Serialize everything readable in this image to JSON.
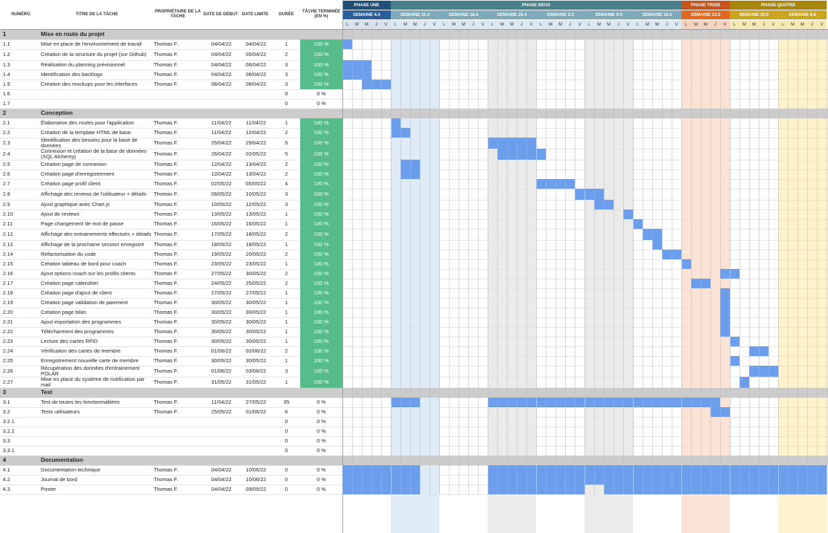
{
  "headers": {
    "num": "NUMÉRO",
    "title": "TITRE DE LA TÂCHE",
    "owner": "PROPRIÉTAIRE DE LA TÂCHE",
    "start": "DATE DE DÉBUT",
    "end": "DATE LIMITE",
    "dur": "DURÉE",
    "pct": "TÂCHE TERMINÉE (EN %)"
  },
  "day_letters": [
    "L",
    "M",
    "M",
    "J",
    "V"
  ],
  "phases": [
    {
      "label": "PHASE UNE",
      "color": "#1f4e79",
      "text": "#ffffff",
      "weeks": 1
    },
    {
      "label": "PHASE DEUX",
      "color": "#4a7f8c",
      "text": "#ffffff",
      "weeks": 6
    },
    {
      "label": "PHASE TROIS",
      "color": "#c4541b",
      "text": "#ffffff",
      "weeks": 1
    },
    {
      "label": "PHASE QUATRE",
      "color": "#a8860e",
      "text": "#ffffff",
      "weeks": 2
    }
  ],
  "weeks": [
    {
      "label": "SEMAINE 4.4",
      "color": "#2a5d9a",
      "daybg": "#d9e3f0",
      "fill": "#ffffff"
    },
    {
      "label": "SEMAINE 11.4",
      "color": "#7faabc",
      "daybg": "#dbe9f2",
      "fill": "#dfecf7"
    },
    {
      "label": "SEMAINE 18.4",
      "color": "#7faabc",
      "daybg": "#dbe9f2",
      "fill": "#ffffff"
    },
    {
      "label": "SEMAINE 25.4",
      "color": "#7faabc",
      "daybg": "#dbe9f2",
      "fill": "#ebebeb"
    },
    {
      "label": "SEMAINE 2.5",
      "color": "#7faabc",
      "daybg": "#dbe9f2",
      "fill": "#ffffff"
    },
    {
      "label": "SEMAINE 9.5",
      "color": "#7faabc",
      "daybg": "#dbe9f2",
      "fill": "#ebebeb"
    },
    {
      "label": "SEMAINE 16.5",
      "color": "#7faabc",
      "daybg": "#dbe9f2",
      "fill": "#ffffff"
    },
    {
      "label": "SEMAINE 23.5",
      "color": "#e0691f",
      "daybg": "#f8d3c0",
      "fill": "#fbe3d6"
    },
    {
      "label": "SEMAINE 30.5",
      "color": "#c9a522",
      "daybg": "#f7e9b4",
      "fill": "#ffffff"
    },
    {
      "label": "SEMAINE 6.6",
      "color": "#c9a522",
      "daybg": "#f7e9b4",
      "fill": "#fff2cc"
    }
  ],
  "colors": {
    "done": "#57bb8a",
    "bar": "#6d9eeb",
    "section": "#cccccc"
  },
  "rows": [
    {
      "type": "section",
      "num": "1",
      "title": "Mise en route du projet"
    },
    {
      "num": "1.1",
      "title": "Mise en place de l'environnement de travail",
      "owner": "Thomas F.",
      "start": "04/04/22",
      "end": "04/04/22",
      "dur": "1",
      "pct": "100 %",
      "done": true,
      "bars": [
        [
          0,
          1
        ]
      ]
    },
    {
      "num": "1.2",
      "title": "Création de la structure du projet (sur Github)",
      "owner": "Thomas F.",
      "start": "04/04/22",
      "end": "05/04/22",
      "dur": "2",
      "pct": "100 %",
      "done": true,
      "bars": [],
      "tall": true
    },
    {
      "num": "1.3",
      "title": "Réalisation du planning prévisionnel",
      "owner": "Thomas F.",
      "start": "04/04/22",
      "end": "06/04/22",
      "dur": "3",
      "pct": "100 %",
      "done": true,
      "bars": [
        [
          0,
          3
        ]
      ]
    },
    {
      "num": "1.4",
      "title": "Identification des backlogs",
      "owner": "Thomas F.",
      "start": "04/04/22",
      "end": "06/04/22",
      "dur": "3",
      "pct": "100 %",
      "done": true,
      "bars": [
        [
          0,
          3
        ]
      ]
    },
    {
      "num": "1.5",
      "title": "Création des mockups pour les interfaces",
      "owner": "Thomas F.",
      "start": "06/04/22",
      "end": "08/04/22",
      "dur": "3",
      "pct": "100 %",
      "done": true,
      "bars": [
        [
          2,
          3
        ]
      ]
    },
    {
      "num": "1.6",
      "title": "",
      "owner": "",
      "start": "",
      "end": "",
      "dur": "0",
      "pct": "0 %",
      "done": false,
      "bars": []
    },
    {
      "num": "1.7",
      "title": "",
      "owner": "",
      "start": "",
      "end": "",
      "dur": "0",
      "pct": "0 %",
      "done": false,
      "bars": []
    },
    {
      "type": "section",
      "num": "2",
      "title": "Conception"
    },
    {
      "num": "2.1",
      "title": "Élaboration des routes pour l'application",
      "owner": "Thomas F.",
      "start": "11/04/22",
      "end": "11/04/22",
      "dur": "1",
      "pct": "100 %",
      "done": true,
      "bars": [
        [
          5,
          1
        ]
      ]
    },
    {
      "num": "2.2",
      "title": "Création de la template HTML de base",
      "owner": "Thomas F.",
      "start": "11/04/22",
      "end": "12/04/22",
      "dur": "2",
      "pct": "100 %",
      "done": true,
      "bars": [
        [
          5,
          2
        ]
      ]
    },
    {
      "num": "2.3",
      "title": "Identification des besoins pour la base de données",
      "owner": "Thomas F.",
      "start": "25/04/22",
      "end": "29/04/22",
      "dur": "5",
      "pct": "100 %",
      "done": true,
      "bars": [
        [
          15,
          5
        ]
      ],
      "tall": true
    },
    {
      "num": "2.4",
      "title": "Connexion et création de la base de données (SQL Alchemy)",
      "owner": "Thomas F.",
      "start": "26/04/22",
      "end": "02/05/22",
      "dur": "5",
      "pct": "100 %",
      "done": true,
      "bars": [
        [
          16,
          5
        ]
      ],
      "tall": true
    },
    {
      "num": "2.5",
      "title": "Création page de connexion",
      "owner": "Thomas F.",
      "start": "12/04/22",
      "end": "13/04/22",
      "dur": "2",
      "pct": "100 %",
      "done": true,
      "bars": [
        [
          6,
          2
        ]
      ]
    },
    {
      "num": "2.6",
      "title": "Création page d'enregistrement",
      "owner": "Thomas F.",
      "start": "12/04/22",
      "end": "13/04/22",
      "dur": "2",
      "pct": "100 %",
      "done": true,
      "bars": [
        [
          6,
          2
        ]
      ]
    },
    {
      "num": "2.7",
      "title": "Création page profil client",
      "owner": "Thomas F.",
      "start": "02/05/22",
      "end": "05/05/22",
      "dur": "4",
      "pct": "100 %",
      "done": true,
      "bars": [
        [
          20,
          4
        ]
      ]
    },
    {
      "num": "2.8",
      "title": "Affichage des reviews de l'utilisateur + détails",
      "owner": "Thomas F.",
      "start": "06/05/22",
      "end": "10/05/22",
      "dur": "3",
      "pct": "100 %",
      "done": true,
      "bars": [
        [
          24,
          3
        ]
      ],
      "tall": true
    },
    {
      "num": "2.9",
      "title": "Ajout graphique avec Chart.js",
      "owner": "Thomas F.",
      "start": "10/05/22",
      "end": "12/05/22",
      "dur": "3",
      "pct": "100 %",
      "done": true,
      "bars": [
        [
          26,
          2
        ]
      ]
    },
    {
      "num": "2.10",
      "title": "Ajout de reviews",
      "owner": "Thomas F.",
      "start": "13/05/22",
      "end": "13/05/22",
      "dur": "1",
      "pct": "100 %",
      "done": true,
      "bars": [
        [
          29,
          1
        ]
      ]
    },
    {
      "num": "2.11",
      "title": "Page changement de mot de passe",
      "owner": "Thomas F.",
      "start": "16/05/22",
      "end": "16/05/22",
      "dur": "1",
      "pct": "100 %",
      "done": true,
      "bars": [
        [
          30,
          1
        ]
      ]
    },
    {
      "num": "2.12",
      "title": "Affichage des entrainements effectués + détails",
      "owner": "Thomas F.",
      "start": "17/05/22",
      "end": "18/05/22",
      "dur": "2",
      "pct": "100 %",
      "done": true,
      "bars": [
        [
          31,
          2
        ]
      ],
      "tall": true
    },
    {
      "num": "2.13",
      "title": "Affichage de la prochaine session enregistré",
      "owner": "Thomas F.",
      "start": "18/05/22",
      "end": "18/05/22",
      "dur": "1",
      "pct": "100 %",
      "done": true,
      "bars": [
        [
          32,
          1
        ]
      ]
    },
    {
      "num": "2.14",
      "title": "Refactorisation du code",
      "owner": "Thomas F.",
      "start": "19/05/22",
      "end": "20/05/22",
      "dur": "2",
      "pct": "100 %",
      "done": true,
      "bars": [
        [
          33,
          2
        ]
      ]
    },
    {
      "num": "2.15",
      "title": "Création tableau de bord pour coach",
      "owner": "Thomas F.",
      "start": "23/05/22",
      "end": "23/05/22",
      "dur": "1",
      "pct": "100 %",
      "done": true,
      "bars": [
        [
          35,
          1
        ]
      ]
    },
    {
      "num": "2.16",
      "title": "Ajout options coach sur les profils clients",
      "owner": "Thomas F.",
      "start": "27/05/22",
      "end": "30/05/22",
      "dur": "2",
      "pct": "100 %",
      "done": true,
      "bars": [
        [
          39,
          2
        ]
      ]
    },
    {
      "num": "2.17",
      "title": "Création page calendrier",
      "owner": "Thomas F.",
      "start": "24/05/22",
      "end": "25/05/22",
      "dur": "2",
      "pct": "100 %",
      "done": true,
      "bars": [
        [
          36,
          2
        ]
      ]
    },
    {
      "num": "2.18",
      "title": "Création page d'ajout de client",
      "owner": "Thomas F.",
      "start": "27/05/22",
      "end": "27/05/22",
      "dur": "1",
      "pct": "100 %",
      "done": true,
      "bars": [
        [
          39,
          1
        ]
      ]
    },
    {
      "num": "2.19",
      "title": "Création page validation de paiement",
      "owner": "Thomas F.",
      "start": "30/05/22",
      "end": "30/05/22",
      "dur": "1",
      "pct": "100 %",
      "done": true,
      "bars": [
        [
          39,
          1
        ]
      ]
    },
    {
      "num": "2.20",
      "title": "Création page bilan",
      "owner": "Thomas F.",
      "start": "30/05/22",
      "end": "30/05/22",
      "dur": "1",
      "pct": "100 %",
      "done": true,
      "bars": [
        [
          39,
          1
        ]
      ]
    },
    {
      "num": "2.21",
      "title": "Ajout importation des programmes",
      "owner": "Thomas F.",
      "start": "30/05/22",
      "end": "30/05/22",
      "dur": "1",
      "pct": "100 %",
      "done": true,
      "bars": [
        [
          39,
          1
        ]
      ]
    },
    {
      "num": "2.22",
      "title": "Télécharment des programmes",
      "owner": "Thomas F.",
      "start": "30/05/22",
      "end": "30/05/22",
      "dur": "1",
      "pct": "100 %",
      "done": true,
      "bars": [
        [
          39,
          1
        ]
      ]
    },
    {
      "num": "2.23",
      "title": "Lecture des cartes RFID",
      "owner": "Thomas F.",
      "start": "30/05/22",
      "end": "30/05/22",
      "dur": "1",
      "pct": "100 %",
      "done": true,
      "bars": [
        [
          40,
          1
        ]
      ]
    },
    {
      "num": "2.24",
      "title": "Vérification des cartes de membre",
      "owner": "Thomas F.",
      "start": "01/06/22",
      "end": "02/06/22",
      "dur": "2",
      "pct": "100 %",
      "done": true,
      "bars": [
        [
          42,
          2
        ]
      ]
    },
    {
      "num": "2.25",
      "title": "Enregistrement nouvelle carte de membre",
      "owner": "Thomas F.",
      "start": "30/05/22",
      "end": "30/05/22",
      "dur": "1",
      "pct": "100 %",
      "done": true,
      "bars": [
        [
          40,
          1
        ]
      ]
    },
    {
      "num": "2.26",
      "title": "Récupération des données d'entrainement POLAR",
      "owner": "Thomas F.",
      "start": "01/06/22",
      "end": "03/06/22",
      "dur": "3",
      "pct": "100 %",
      "done": true,
      "bars": [
        [
          42,
          3
        ]
      ],
      "tall": true
    },
    {
      "num": "2.27",
      "title": "Mise en place du système de notification par mail",
      "owner": "Thomas F.",
      "start": "31/05/22",
      "end": "31/05/22",
      "dur": "1",
      "pct": "100 %",
      "done": true,
      "bars": [
        [
          41,
          1
        ]
      ],
      "tall": true
    },
    {
      "type": "section",
      "num": "3",
      "title": "Test"
    },
    {
      "num": "3.1",
      "title": "Test de toutes les fonctionnalitées",
      "owner": "Thomas F.",
      "start": "11/04/22",
      "end": "27/05/22",
      "dur": "35",
      "pct": "0 %",
      "done": false,
      "bars": [
        [
          5,
          3
        ],
        [
          15,
          24
        ]
      ]
    },
    {
      "num": "3.2",
      "title": "Tests utilisateurs",
      "owner": "Thomas F.",
      "start": "25/05/22",
      "end": "01/06/22",
      "dur": "6",
      "pct": "0 %",
      "done": false,
      "bars": [
        [
          38,
          2
        ]
      ]
    },
    {
      "num": "3.2.1",
      "title": "",
      "owner": "",
      "start": "",
      "end": "",
      "dur": "0",
      "pct": "0 %",
      "done": false,
      "bars": []
    },
    {
      "num": "3.2.2",
      "title": "",
      "owner": "",
      "start": "",
      "end": "",
      "dur": "0",
      "pct": "0 %",
      "done": false,
      "bars": []
    },
    {
      "num": "3.3",
      "title": "",
      "owner": "",
      "start": "",
      "end": "",
      "dur": "0",
      "pct": "0 %",
      "done": false,
      "bars": []
    },
    {
      "num": "3.3.1",
      "title": "",
      "owner": "",
      "start": "",
      "end": "",
      "dur": "0",
      "pct": "0 %",
      "done": false,
      "bars": []
    },
    {
      "type": "section",
      "num": "4",
      "title": "Documentation"
    },
    {
      "num": "4.1",
      "title": "Documentation technique",
      "owner": "Thomas F.",
      "start": "04/04/22",
      "end": "10/06/22",
      "dur": "0",
      "pct": "0 %",
      "done": false,
      "bars": [
        [
          0,
          8
        ],
        [
          15,
          35
        ]
      ]
    },
    {
      "num": "4.2",
      "title": "Journal de bord",
      "owner": "Thomas F.",
      "start": "04/04/22",
      "end": "10/06/22",
      "dur": "0",
      "pct": "0 %",
      "done": false,
      "bars": [
        [
          0,
          8
        ],
        [
          15,
          35
        ]
      ]
    },
    {
      "num": "4.3",
      "title": "Poster",
      "owner": "Thomas F.",
      "start": "04/04/22",
      "end": "09/05/22",
      "dur": "0",
      "pct": "0 %",
      "done": false,
      "bars": [
        [
          0,
          8
        ],
        [
          15,
          10
        ],
        [
          27,
          23
        ]
      ]
    }
  ]
}
